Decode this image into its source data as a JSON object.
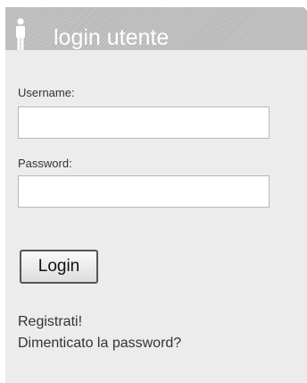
{
  "header": {
    "icon": "user-icon",
    "title": "login utente"
  },
  "form": {
    "username_label": "Username:",
    "username_value": "",
    "password_label": "Password:",
    "password_value": "",
    "login_button": "Login"
  },
  "links": {
    "register": "Registrati!",
    "forgot_password": "Dimenticato la password?"
  },
  "colors": {
    "header_bg": "#b9b9b9",
    "panel_bg": "#ececec",
    "text": "#333333"
  }
}
